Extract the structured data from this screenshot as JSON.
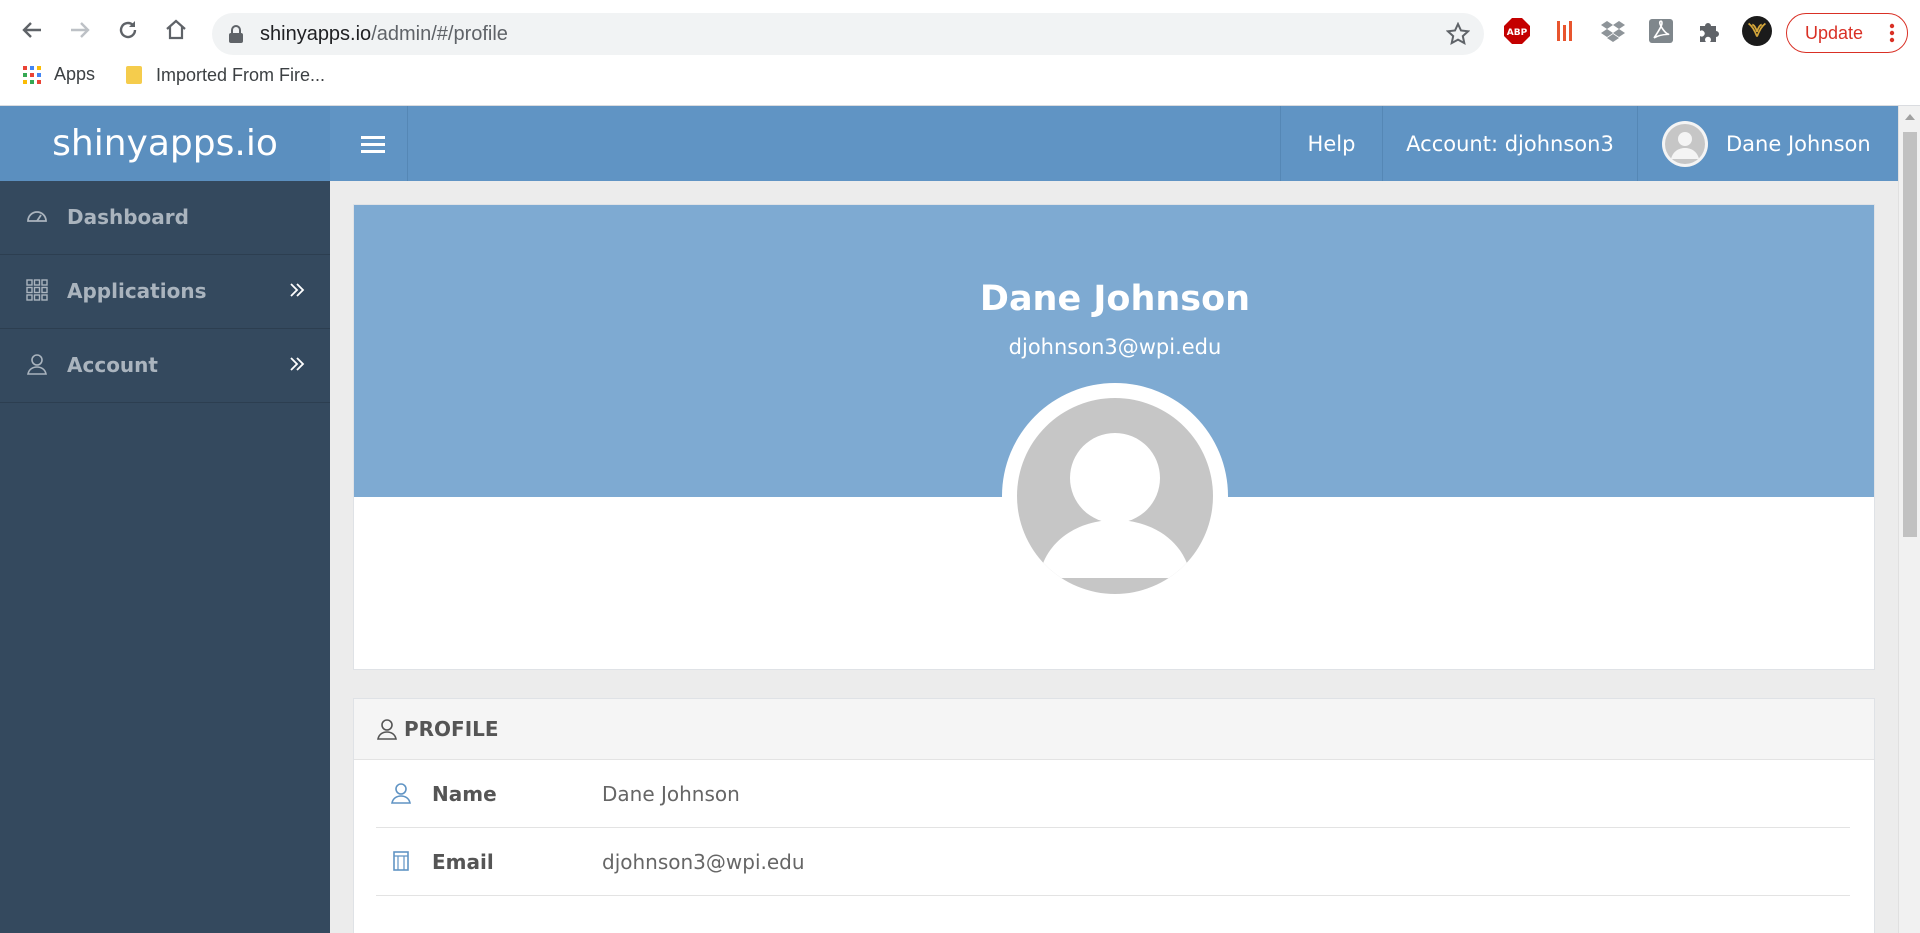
{
  "browser": {
    "url_host": "shinyapps.io",
    "url_path": "/admin/#/profile",
    "update_label": "Update",
    "bookmarks": [
      {
        "label": "Apps"
      },
      {
        "label": "Imported From Fire..."
      }
    ],
    "extensions": [
      "adblock-plus-icon",
      "red-extension-icon",
      "dropbox-icon",
      "pdf-icon",
      "puzzle-extensions-icon",
      "profile-avatar-icon"
    ]
  },
  "header": {
    "brand": "shinyapps.io",
    "help": "Help",
    "account": "Account:  djohnson3",
    "user": "Dane Johnson"
  },
  "sidebar": {
    "items": [
      {
        "label": "Dashboard",
        "icon": "dashboard-gauge-icon"
      },
      {
        "label": "Applications",
        "icon": "grid-icon"
      },
      {
        "label": "Account",
        "icon": "user-icon"
      }
    ]
  },
  "profile_card": {
    "name": "Dane Johnson",
    "email": "djohnson3@wpi.edu"
  },
  "profile_section": {
    "title": "PROFILE",
    "rows": [
      {
        "label": "Name",
        "value": "Dane Johnson",
        "icon": "user-icon"
      },
      {
        "label": "Email",
        "value": "djohnson3@wpi.edu",
        "icon": "mailbox-icon"
      }
    ]
  },
  "colors": {
    "header": "#6094c4",
    "sidebar": "#34495e",
    "banner": "#7eaad2",
    "update": "#d93025"
  }
}
